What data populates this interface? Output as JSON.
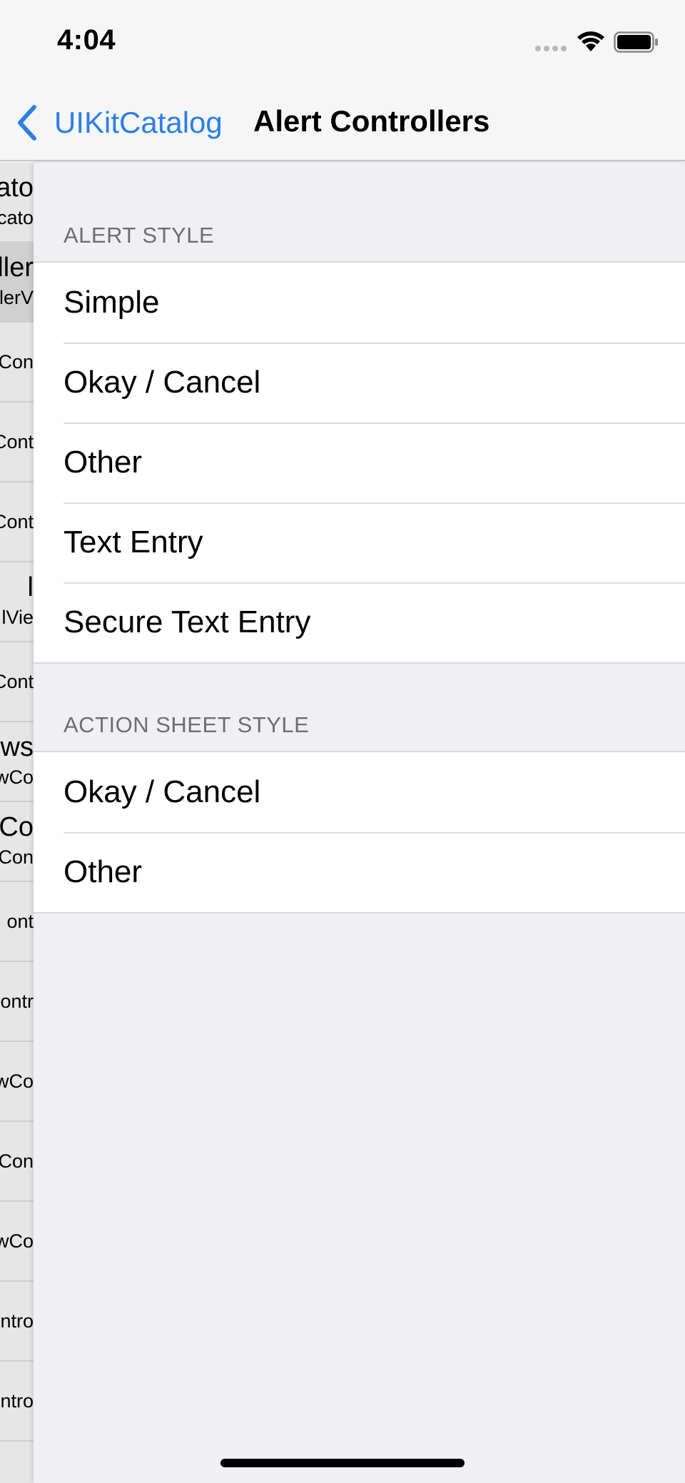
{
  "status_bar": {
    "time": "4:04"
  },
  "nav": {
    "back_label": "UIKitCatalog",
    "title": "Alert Controllers"
  },
  "master_rows": [
    {
      "title": "cato",
      "subtitle": "cato",
      "selected": false
    },
    {
      "title": "ller",
      "subtitle": "llerV",
      "selected": true
    },
    {
      "title": "",
      "subtitle": "Con",
      "selected": false
    },
    {
      "title": "",
      "subtitle": "Cont",
      "selected": false
    },
    {
      "title": "",
      "subtitle": "Cont",
      "selected": false
    },
    {
      "title": "l",
      "subtitle": "lVie",
      "selected": false
    },
    {
      "title": "",
      "subtitle": "Cont",
      "selected": false
    },
    {
      "title": "ws",
      "subtitle": "wCo",
      "selected": false
    },
    {
      "title": "Co",
      "subtitle": "Con",
      "selected": false
    },
    {
      "title": "",
      "subtitle": "ont",
      "selected": false
    },
    {
      "title": "",
      "subtitle": "ontr",
      "selected": false
    },
    {
      "title": "",
      "subtitle": "wCo",
      "selected": false
    },
    {
      "title": "",
      "subtitle": "Con",
      "selected": false
    },
    {
      "title": "",
      "subtitle": "wCo",
      "selected": false
    },
    {
      "title": "",
      "subtitle": "ntro",
      "selected": false
    },
    {
      "title": "",
      "subtitle": "ntro",
      "selected": false
    }
  ],
  "sections": [
    {
      "header": "ALERT STYLE",
      "items": [
        "Simple",
        "Okay / Cancel",
        "Other",
        "Text Entry",
        "Secure Text Entry"
      ]
    },
    {
      "header": "ACTION SHEET STYLE",
      "items": [
        "Okay / Cancel",
        "Other"
      ]
    }
  ],
  "colors": {
    "accent": "#2a7fe8",
    "background": "#efeff4",
    "header_text": "#6d6d72"
  },
  "icons": [
    "chevron-left-icon",
    "cellular-signal-icon",
    "wifi-icon",
    "battery-icon"
  ]
}
